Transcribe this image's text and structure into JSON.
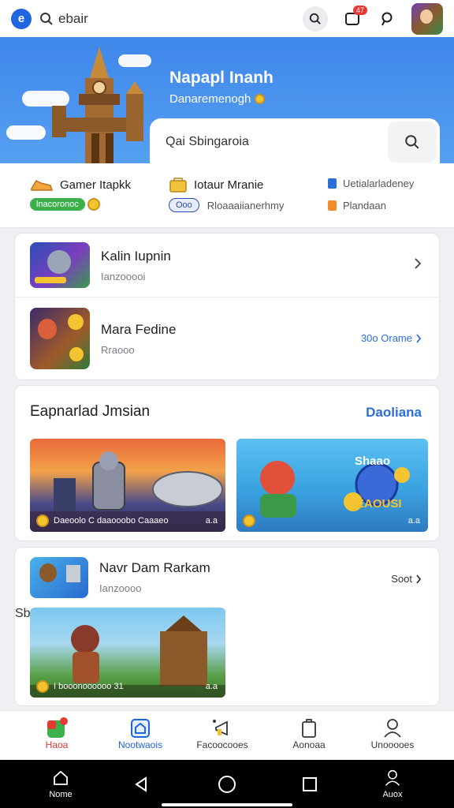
{
  "top_bar": {
    "search_text": "ebair",
    "notif_badge": "47"
  },
  "hero": {
    "title": "Napapl Inanh",
    "subtitle": "Danaremenogh",
    "search_placeholder": "Qai Sbingaroia"
  },
  "stats": {
    "game_label": "Gamer Itapkk",
    "game_pill": "lnacoronoc",
    "total_label": "Iotaur Mranie",
    "total_pill": "Ooo",
    "total_sub": "Rloaaaiianerhmy",
    "right_top": "Uetialarladeney",
    "right_bottom": "Plandaan"
  },
  "list1": [
    {
      "name": "Kalin Iupnin",
      "sub": "Ianzooooi"
    },
    {
      "name": "Mara Fedine",
      "sub": "Rraooo",
      "more": "30o Orame"
    }
  ],
  "section": {
    "title": "Eapnarlad Jmsian",
    "link": "Daoliana"
  },
  "banners": [
    {
      "caption": "Daeoolo  C daaooobo  Caaaeo",
      "count": "a.a"
    },
    {
      "caption": "",
      "count": "a.a",
      "headline": "Shaao",
      "subhead": "EAOUSI"
    }
  ],
  "list2": [
    {
      "name": "Navr Dam Rarkam",
      "sub": "Ianzoooo",
      "more": "Soot"
    },
    {
      "more": "Sbor",
      "caption": "I  booonoooooo  31",
      "count": "a.a"
    }
  ],
  "tabs": [
    {
      "label": "Haoa"
    },
    {
      "label": "Nootwaois"
    },
    {
      "label": "Facoocooes"
    },
    {
      "label": "Aonoaa"
    },
    {
      "label": "Unooooes"
    }
  ],
  "nav": {
    "home": "Nome",
    "account": "Auox"
  },
  "colors": {
    "accent": "#1f66e0",
    "hero_blue": "#3f86ea",
    "link": "#2b6fd8"
  }
}
